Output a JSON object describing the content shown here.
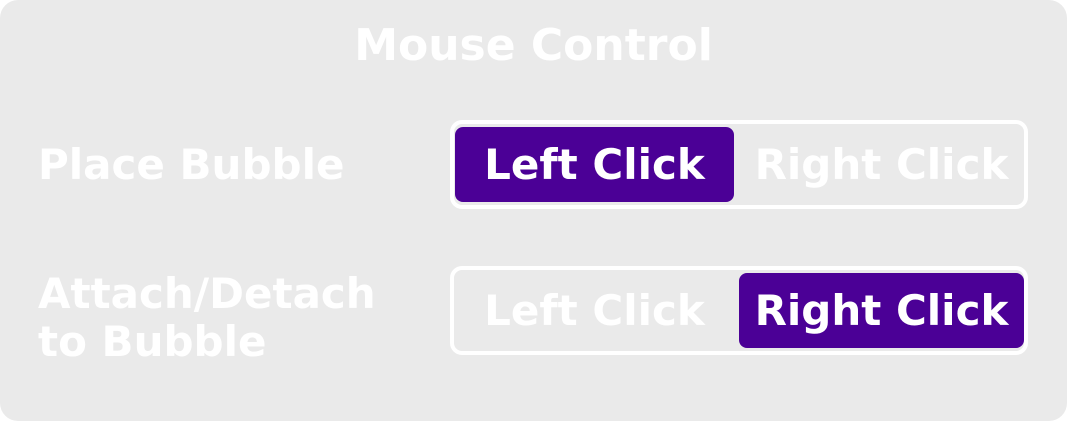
{
  "panel": {
    "title": "Mouse Control",
    "colors": {
      "background": "#eaeaea",
      "accent": "#4b0096",
      "text": "#ffffff"
    }
  },
  "settings": [
    {
      "label": "Place Bubble",
      "options": [
        "Left Click",
        "Right Click"
      ],
      "selected": "Left Click"
    },
    {
      "label": "Attach/Detach to Bubble",
      "options": [
        "Left Click",
        "Right Click"
      ],
      "selected": "Right Click"
    }
  ]
}
